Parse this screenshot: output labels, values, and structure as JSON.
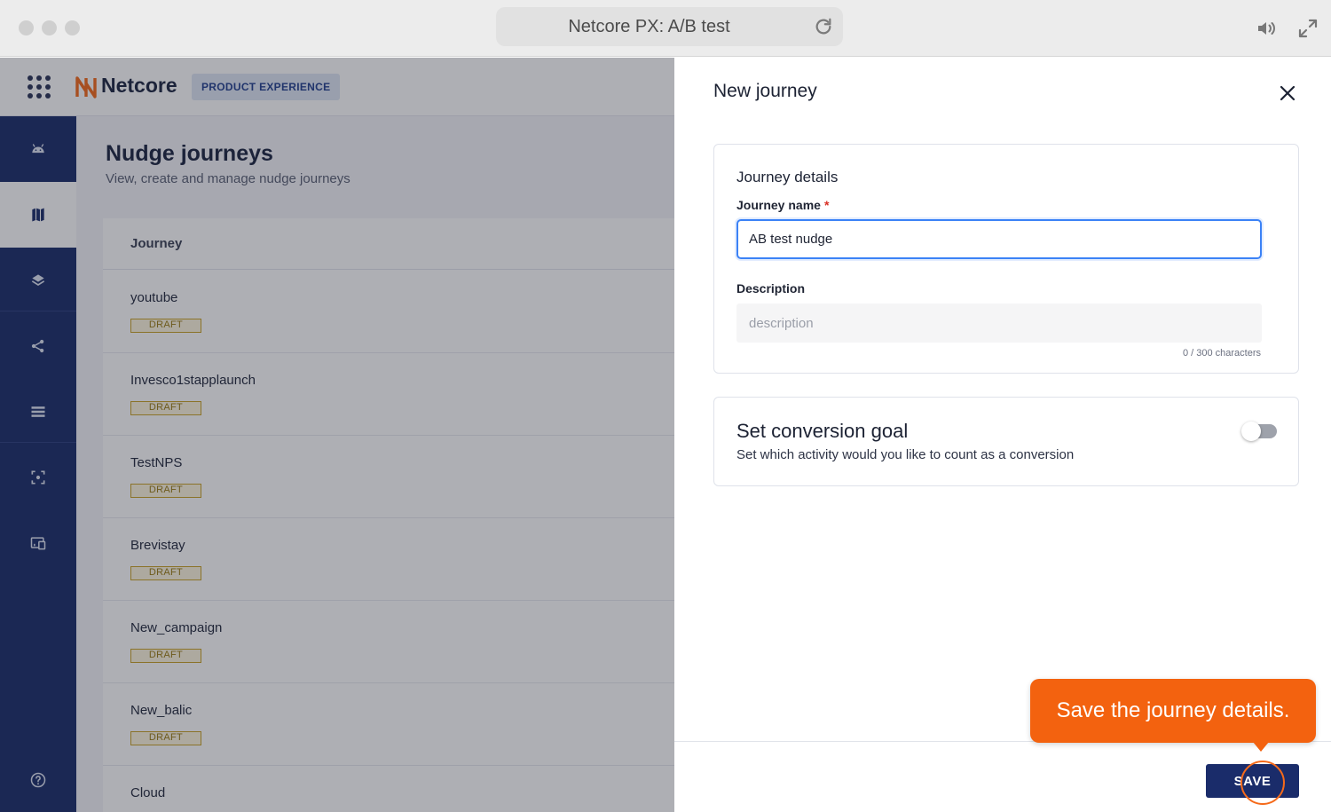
{
  "window": {
    "title": "Netcore PX: A/B test",
    "traffic_lights": [
      "close",
      "minimize",
      "zoom"
    ],
    "icons": [
      "reload-icon",
      "speaker-icon",
      "fullscreen-icon"
    ]
  },
  "header": {
    "logo_text": "Netcore",
    "product_badge": "PRODUCT EXPERIENCE",
    "icons": [
      "apps-grid-icon",
      "netcore-logo-icon"
    ]
  },
  "sidebar": {
    "items": [
      {
        "icon": "android-icon",
        "active": false
      },
      {
        "icon": "map-icon",
        "active": true
      },
      {
        "icon": "layers-icon",
        "active": false
      },
      {
        "icon": "share-icon",
        "active": false
      },
      {
        "icon": "list-icon",
        "active": false
      },
      {
        "icon": "scan-icon",
        "active": false
      },
      {
        "icon": "devices-icon",
        "active": false
      }
    ],
    "help_icon": "help-icon"
  },
  "main": {
    "title": "Nudge journeys",
    "subtitle": "View, create and manage nudge journeys",
    "table": {
      "column_header": "Journey",
      "rows": [
        {
          "name": "youtube",
          "status": "DRAFT"
        },
        {
          "name": "Invesco1stapplaunch",
          "status": "DRAFT"
        },
        {
          "name": "TestNPS",
          "status": "DRAFT"
        },
        {
          "name": "Brevistay",
          "status": "DRAFT"
        },
        {
          "name": "New_campaign",
          "status": "DRAFT"
        },
        {
          "name": "New_balic",
          "status": "DRAFT"
        },
        {
          "name": "Cloud",
          "status": ""
        }
      ]
    }
  },
  "drawer": {
    "title": "New journey",
    "details": {
      "section_title": "Journey details",
      "name_label": "Journey name",
      "required_mark": "*",
      "name_value": "AB test nudge",
      "description_label": "Description",
      "description_placeholder": "description",
      "description_value": "",
      "char_count": "0 / 300 characters"
    },
    "conversion": {
      "title": "Set conversion goal",
      "subtitle": "Set which activity would you like to count as a conversion",
      "enabled": false
    },
    "save_label": "SAVE"
  },
  "guide": {
    "tooltip": "Save the journey details."
  },
  "colors": {
    "sidebar": "#1a2c6a",
    "accent_blue": "#3b82f6",
    "badge_draft": "#c9a227",
    "tooltip": "#f3620f",
    "save_button": "#1a2c6a"
  }
}
